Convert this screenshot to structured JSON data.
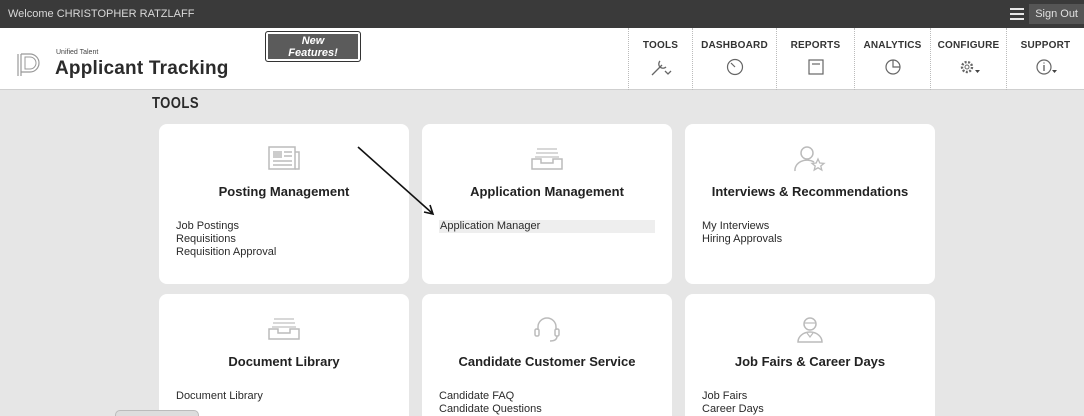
{
  "topbar": {
    "welcome": "Welcome CHRISTOPHER RATZLAFF",
    "signout": "Sign Out"
  },
  "brand": {
    "small": "Unified Talent",
    "big": "Applicant Tracking",
    "new_features": [
      "New",
      "Features!"
    ]
  },
  "nav": [
    {
      "label": "TOOLS",
      "icon": "wrench-icon"
    },
    {
      "label": "DASHBOARD",
      "icon": "gauge-icon"
    },
    {
      "label": "REPORTS",
      "icon": "report-icon"
    },
    {
      "label": "ANALYTICS",
      "icon": "pie-chart-icon"
    },
    {
      "label": "CONFIGURE",
      "icon": "gear-icon"
    },
    {
      "label": "SUPPORT",
      "icon": "info-icon"
    }
  ],
  "page_title": "TOOLS",
  "cards": [
    {
      "title": "Posting Management",
      "icon": "newspaper-icon",
      "links": [
        "Job Postings",
        "Requisitions",
        "Requisition Approval"
      ]
    },
    {
      "title": "Application Management",
      "icon": "inbox-tray-icon",
      "links": [
        "Application Manager"
      ]
    },
    {
      "title": "Interviews & Recommendations",
      "icon": "person-star-icon",
      "links": [
        "My Interviews",
        "Hiring Approvals"
      ]
    },
    {
      "title": "Document Library",
      "icon": "file-tray-icon",
      "links": [
        "Document Library"
      ]
    },
    {
      "title": "Candidate Customer Service",
      "icon": "headset-icon",
      "links": [
        "Candidate FAQ",
        "Candidate Questions"
      ]
    },
    {
      "title": "Job Fairs & Career Days",
      "icon": "recruiter-icon",
      "links": [
        "Job Fairs",
        "Career Days"
      ]
    }
  ]
}
